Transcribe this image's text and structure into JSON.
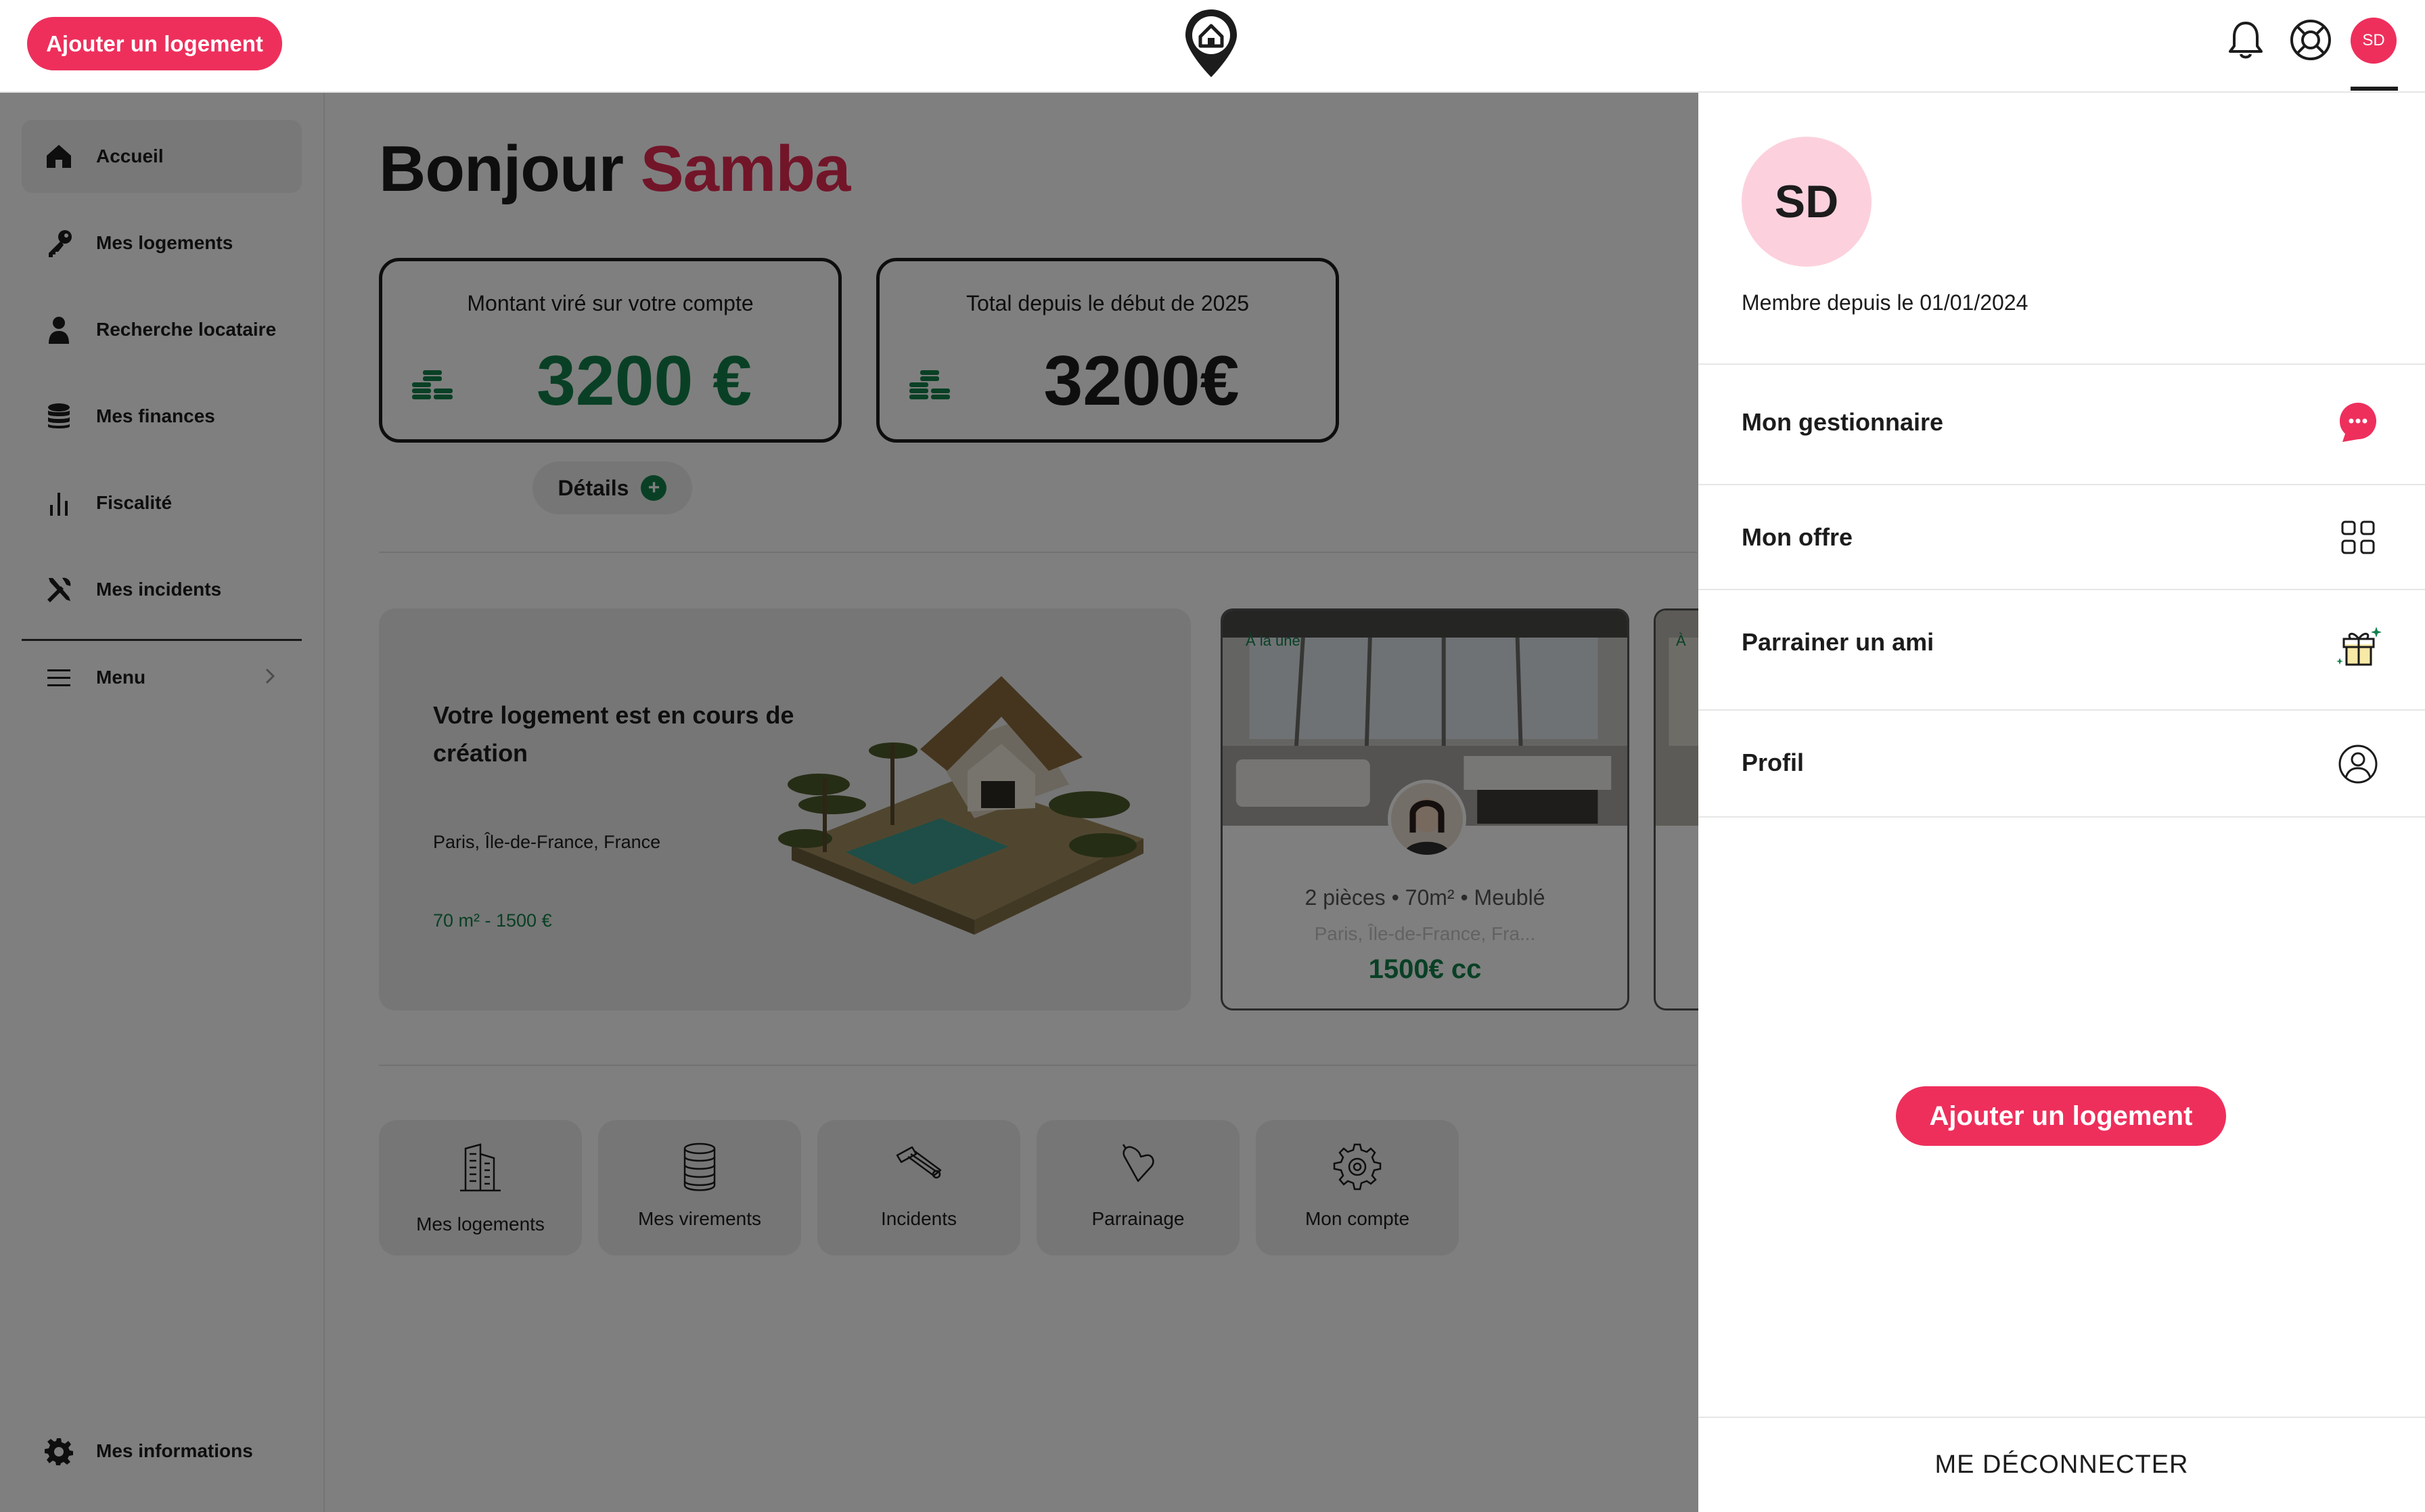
{
  "header": {
    "add_button": "Ajouter un logement",
    "icons": [
      "bell-icon",
      "help-lifebuoy-icon"
    ],
    "avatar_initials": "SD"
  },
  "sidebar": {
    "items": [
      {
        "label": "Accueil",
        "icon": "home-icon",
        "active": true
      },
      {
        "label": "Mes logements",
        "icon": "key-icon"
      },
      {
        "label": "Recherche locataire",
        "icon": "person-icon"
      },
      {
        "label": "Mes finances",
        "icon": "coins-stack-icon"
      },
      {
        "label": "Fiscalité",
        "icon": "bar-chart-icon"
      },
      {
        "label": "Mes incidents",
        "icon": "tools-icon"
      }
    ],
    "menu_label": "Menu",
    "bottom_label": "Mes informations"
  },
  "main": {
    "greeting": "Bonjour",
    "user_name": "Samba",
    "stats": [
      {
        "label": "Montant viré sur votre compte",
        "value": "3200 €"
      },
      {
        "label": "Total depuis le début de 2025",
        "value": "3200€"
      }
    ],
    "details_button": "Détails",
    "creation_card": {
      "title": "Votre logement est en cours de création",
      "location": "Paris, Île-de-France, France",
      "summary": "70 m² - 1500 €"
    },
    "listing": {
      "badge": "À la une",
      "specs": "2 pièces • 70m² • Meublé",
      "location": "Paris, Île-de-France, Fra...",
      "price": "1500€ cc"
    },
    "listing_peek_badge": "À",
    "shortcuts": [
      {
        "label": "Mes logements",
        "icon": "building-icon"
      },
      {
        "label": "Mes virements",
        "icon": "coin-stack-icon"
      },
      {
        "label": "Incidents",
        "icon": "hammer-icon"
      },
      {
        "label": "Parrainage",
        "icon": "heart-tag-icon"
      },
      {
        "label": "Mon compte",
        "icon": "gear-icon"
      }
    ]
  },
  "profile_panel": {
    "initials": "SD",
    "member_since": "Membre depuis le 01/01/2024",
    "items": [
      {
        "label": "Mon gestionnaire",
        "icon": "chat-bubble-icon"
      },
      {
        "label": "Mon offre",
        "icon": "grid-icon"
      },
      {
        "label": "Parrainer un ami",
        "icon": "gift-icon"
      },
      {
        "label": "Profil",
        "icon": "user-circle-icon"
      }
    ],
    "add_button": "Ajouter un logement",
    "logout": "ME DÉCONNECTER"
  },
  "colors": {
    "brand_pink": "#ee2f5c",
    "green": "#12804a",
    "avatar_bg": "#fcd1dd"
  }
}
